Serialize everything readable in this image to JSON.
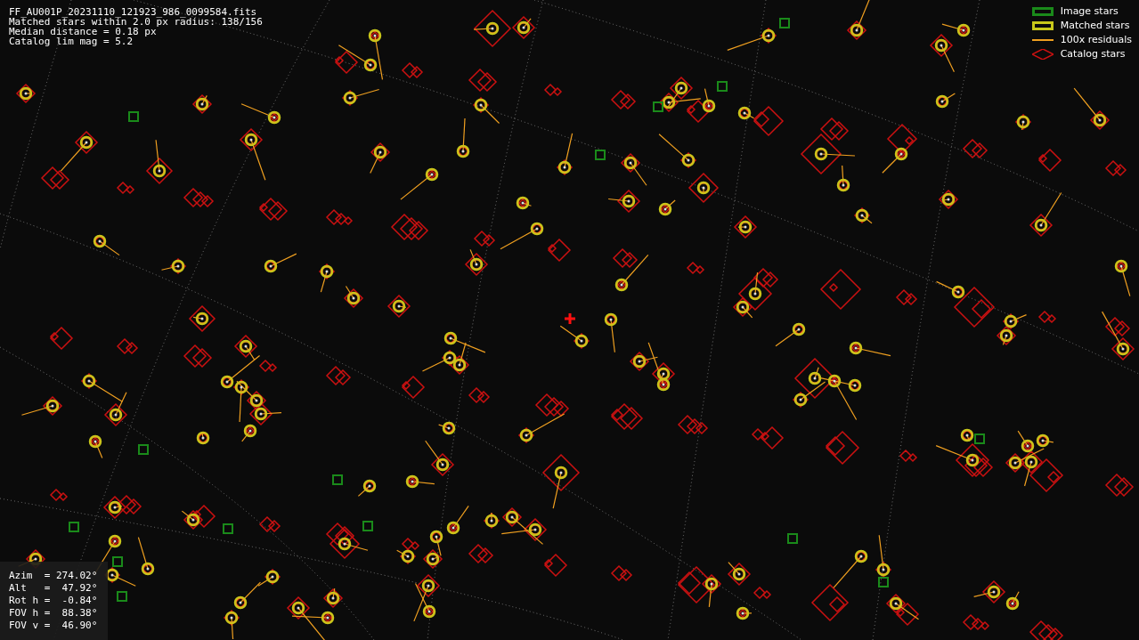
{
  "header_lines": [
    "FF_AU001P_20231110_121923_986_0099584.fits",
    "Matched stars within 2.0 px radius: 138/156",
    "Median distance = 0.18 px",
    "Catalog lim mag = 5.2"
  ],
  "legend": [
    {
      "kind": "square",
      "label": "Image stars",
      "color": "#1a8a1a"
    },
    {
      "kind": "square",
      "label": "Matched stars",
      "color": "#c8c81a"
    },
    {
      "kind": "line",
      "label": "100x residuals",
      "color": "#f0a020"
    },
    {
      "kind": "diamond",
      "label": "Catalog stars",
      "color": "#cc1111"
    }
  ],
  "pointing": [
    "Azim  = 274.02°",
    "Alt   =  47.92°",
    "Rot h =  -0.84°",
    "FOV h =  88.38°",
    "FOV v =  46.90°"
  ]
}
